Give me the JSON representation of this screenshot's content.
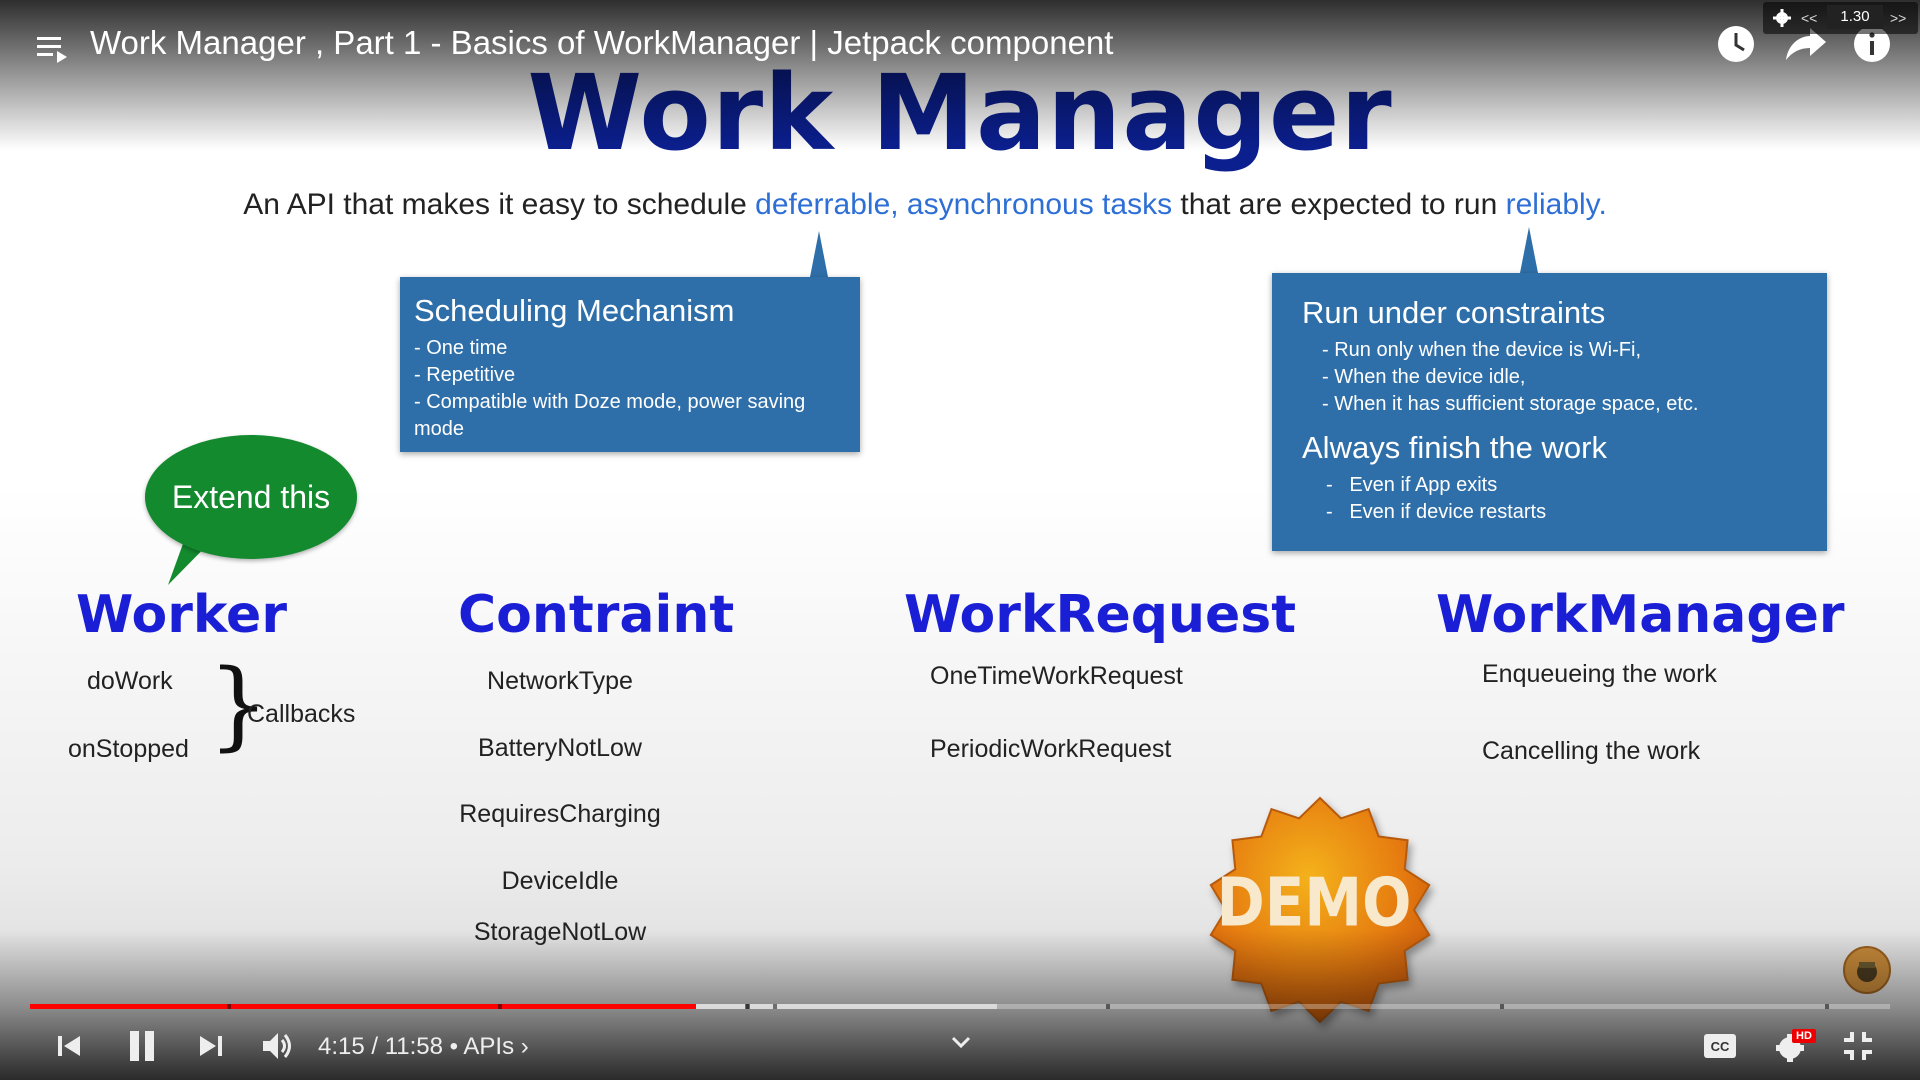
{
  "player": {
    "video_title": "Work Manager , Part 1 - Basics of WorkManager | Jetpack component",
    "speed": "1.30",
    "speed_prev": "<<",
    "speed_next": ">>",
    "time": "4:15 / 11:58",
    "chapter": "• APIs",
    "chapter_arrow": "›",
    "progress_fraction": 0.358,
    "buffered_fraction": 0.52,
    "hd_badge": "HD",
    "accent_color": "#ff0000",
    "icons": [
      "playlist-icon",
      "watch-later-icon",
      "share-icon",
      "info-icon",
      "settings-icon",
      "skip-previous-icon",
      "pause-icon",
      "skip-next-icon",
      "volume-icon",
      "chevron-down-icon",
      "captions-icon",
      "settings-gear-icon",
      "exit-fullscreen-icon"
    ]
  },
  "slide": {
    "title": "Work Manager",
    "subtitle": {
      "part1": "An API that makes it easy to schedule ",
      "highlight1": "deferrable, asynchronous tasks",
      "part2": " that are expected to run ",
      "highlight2": "reliably",
      "part3": "."
    },
    "scheduling_box": {
      "title": "Scheduling  Mechanism",
      "items": [
        "- One time",
        "- Repetitive",
        "- Compatible with Doze mode, power saving mode"
      ]
    },
    "constraints_box": {
      "title": "Run under constraints",
      "items": [
        "- Run only when the device is Wi-Fi,",
        "- When the device idle,",
        "- When it has sufficient storage space, etc."
      ],
      "title2": "Always finish the work",
      "items2": [
        "Even if App exits",
        "Even if device restarts"
      ],
      "bullet": "-"
    },
    "bubble": "Extend this",
    "worker": {
      "heading": "Worker",
      "methods": [
        "doWork",
        "onStopped"
      ],
      "brace": "}",
      "callbacks": "Callbacks"
    },
    "constraint": {
      "heading": "Contraint",
      "items": [
        "NetworkType",
        "BatteryNotLow",
        "RequiresCharging",
        "DeviceIdle",
        "StorageNotLow"
      ]
    },
    "workrequest": {
      "heading": "WorkRequest",
      "items": [
        "OneTimeWorkRequest",
        "PeriodicWorkRequest"
      ]
    },
    "workmanager": {
      "heading": "WorkManager",
      "items": [
        "Enqueueing the work",
        "Cancelling the work"
      ]
    },
    "demo_badge": "DEMO"
  }
}
